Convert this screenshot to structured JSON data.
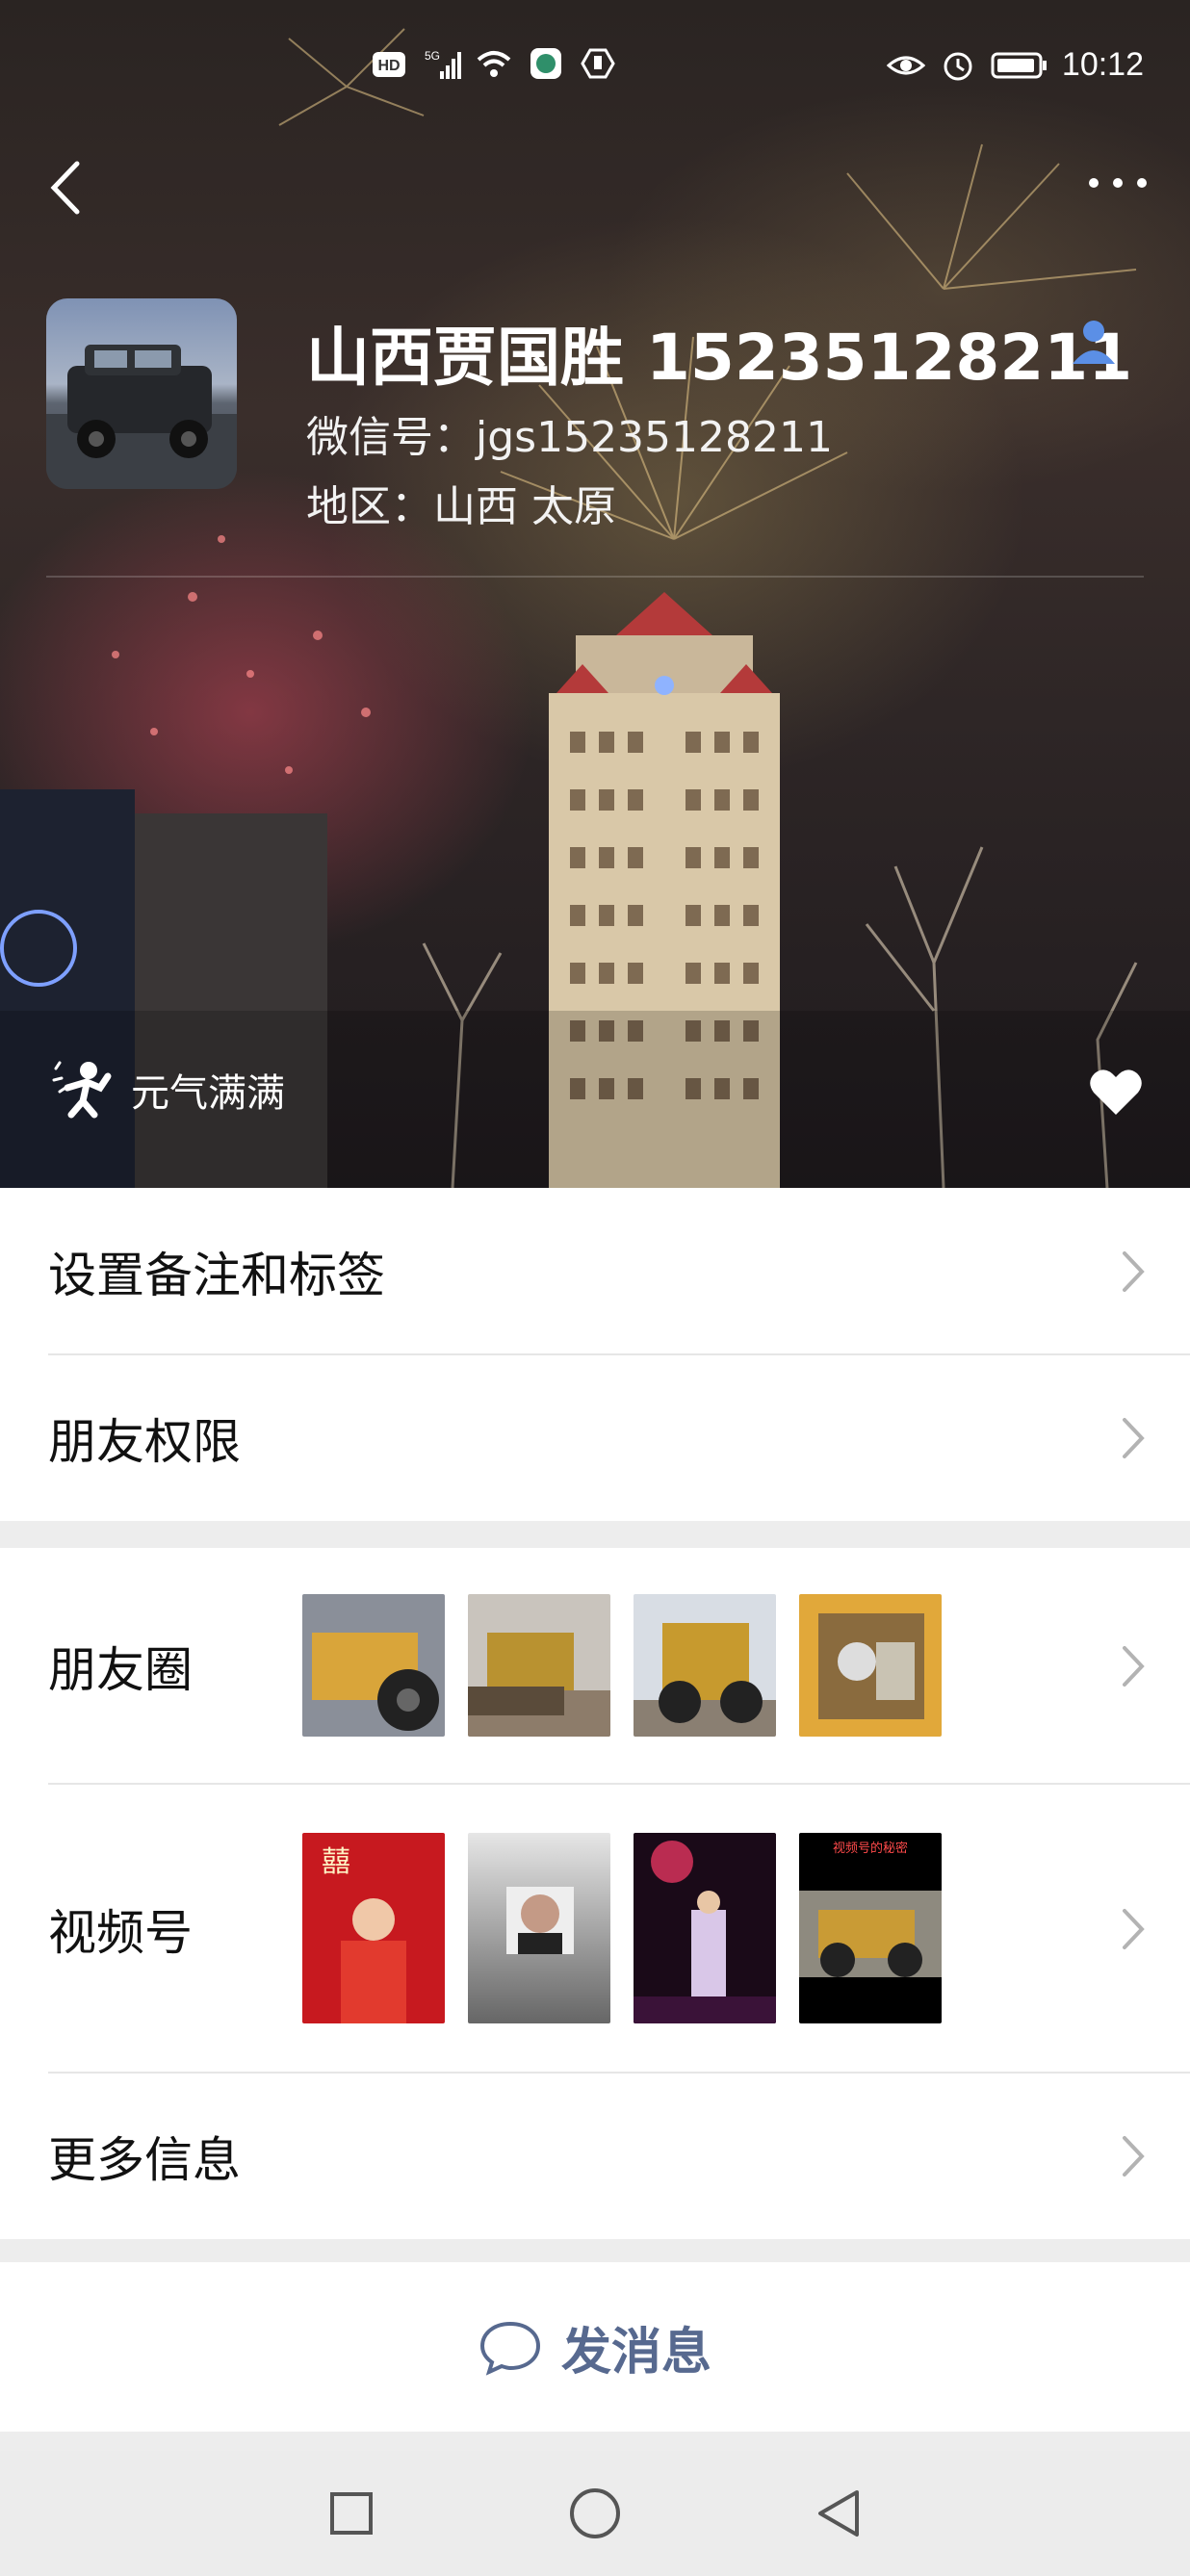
{
  "status_bar": {
    "time": "10:12",
    "network_icons": [
      "hd-icon",
      "5g-signal-icon",
      "wifi-icon",
      "app-notify-icon",
      "hand-icon"
    ],
    "right_icons": [
      "eye-icon",
      "alarm-icon",
      "battery-icon"
    ]
  },
  "header": {
    "back_icon": "chevron-left-icon",
    "more_icon": "more-dots-icon"
  },
  "profile": {
    "name": "山西贾国胜 15235128211",
    "wechat_id": "微信号：jgs15235128211",
    "region": "地区：山西  太原",
    "status_text": "元气满满",
    "status_icon": "energetic-person-icon",
    "like_icon": "heart-icon"
  },
  "menu": {
    "remark_tags": "设置备注和标签",
    "friend_permission": "朋友权限",
    "moments": "朋友圈",
    "channels": "视频号",
    "more_info": "更多信息"
  },
  "channels_thumb_text": {
    "third": "视频号的秘密"
  },
  "actions": {
    "send_message": "发消息"
  },
  "colors": {
    "accent": "#57698f",
    "background": "#ededed",
    "divider": "#e6e6e6"
  }
}
